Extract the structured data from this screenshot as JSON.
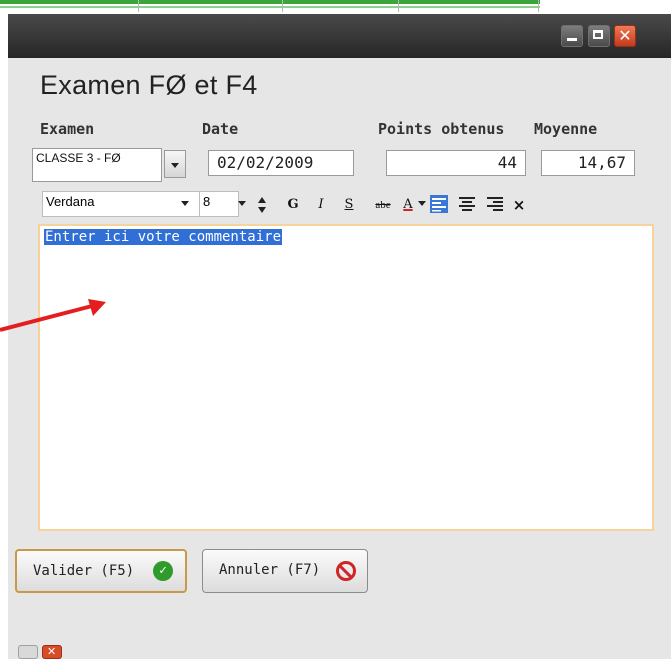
{
  "window": {
    "title": "Examen FØ et F4",
    "controls": {
      "minimize": "minimize",
      "maximize": "maximize",
      "close": "close"
    }
  },
  "fields": {
    "examen": {
      "label": "Examen",
      "value": "CLASSE 3 - FØ"
    },
    "date": {
      "label": "Date",
      "value": "02/02/2009"
    },
    "points": {
      "label": "Points obtenus",
      "value": "44"
    },
    "moyenne": {
      "label": "Moyenne",
      "value": "14,67"
    }
  },
  "toolbar": {
    "font": "Verdana",
    "size": "8",
    "bold": "G",
    "italic": "I",
    "underline": "S",
    "strike": "abe",
    "font_color": "A",
    "clear": "×"
  },
  "editor": {
    "text": "Entrer ici votre commentaire"
  },
  "buttons": {
    "ok": "Valider (F5)",
    "cancel": "Annuler (F7)"
  },
  "colors": {
    "editor_border": "#f7d39b",
    "selection": "#2f6fd6",
    "ok_icon": "#2e9b2a",
    "cancel_icon": "#d12525",
    "annotation_arrow": "#e41e1e"
  },
  "icons": [
    "align-left-icon",
    "align-center-icon",
    "align-right-icon",
    "check-icon",
    "prohibited-icon",
    "spin-up-icon",
    "spin-down-icon"
  ]
}
